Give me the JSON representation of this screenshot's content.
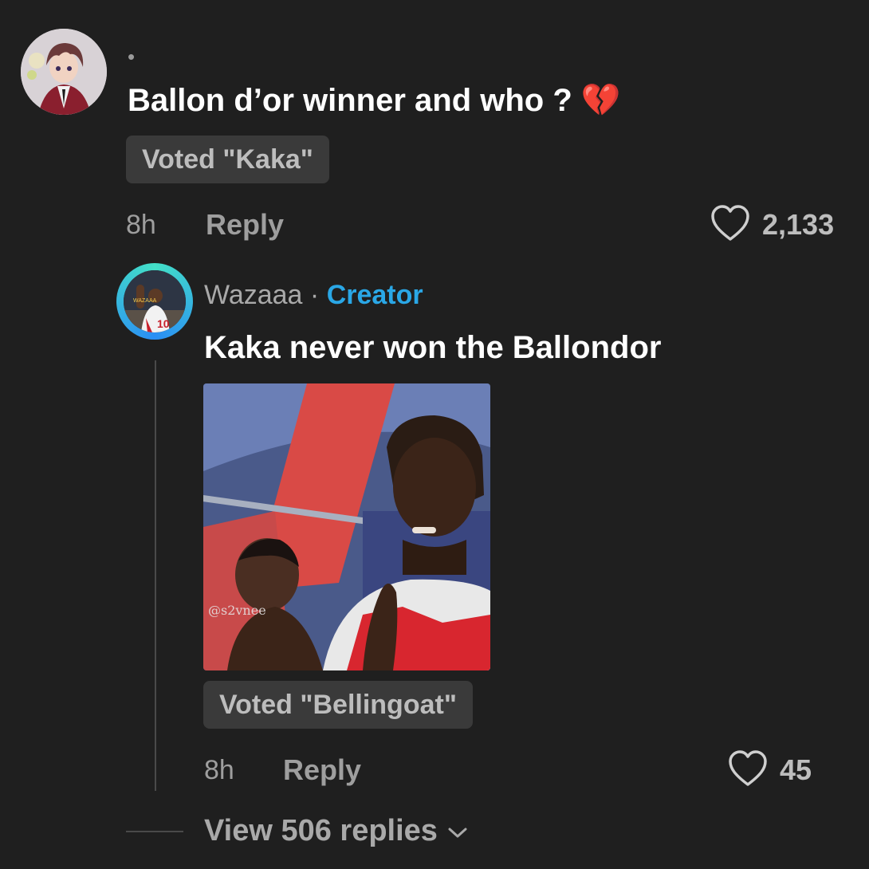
{
  "comment": {
    "username": "•",
    "text": "Ballon d’or winner and who ?",
    "emoji": "💔",
    "vote_label": "Voted \"Kaka\"",
    "time": "8h",
    "reply_label": "Reply",
    "likes": "2,133",
    "heart_icon": "heart-outline-icon"
  },
  "reply": {
    "username": "Wazaaa",
    "separator": "·",
    "creator_label": "Creator",
    "avatar_text": "WAZAAA",
    "text": "Kaka never won the Ballondor",
    "media_watermark": "@s2vnee",
    "vote_label": "Voted \"Bellingoat\"",
    "time": "8h",
    "reply_label": "Reply",
    "likes": "45",
    "heart_icon": "heart-outline-icon"
  },
  "thread": {
    "view_replies_label": "View 506 replies",
    "chevron_icon": "chevron-down-icon"
  },
  "colors": {
    "background": "#1f1f1f",
    "creator_accent": "#2aa7e6",
    "badge_bg": "#3a3a3a"
  }
}
